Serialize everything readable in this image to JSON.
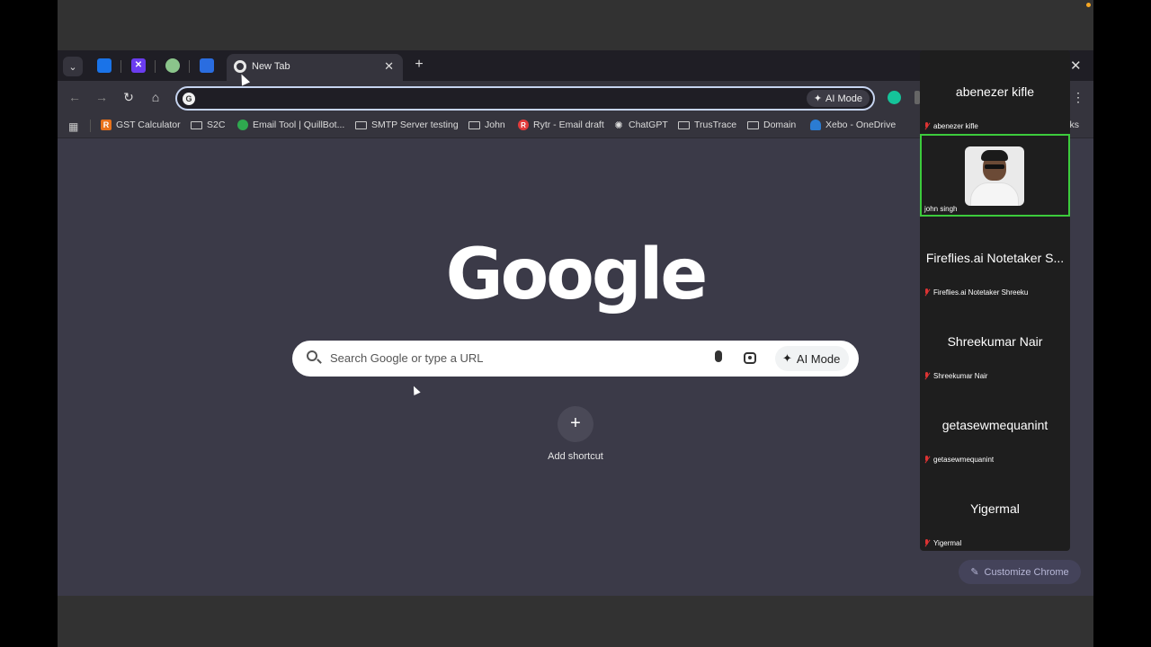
{
  "tabs": {
    "active_title": "New Tab"
  },
  "toolbar": {
    "omnibox_value": "",
    "ai_mode_label": "AI Mode"
  },
  "bookmarks": [
    {
      "label": "GST Calculator",
      "icon": "r-logo-icon"
    },
    {
      "label": "S2C",
      "icon": "folder-icon"
    },
    {
      "label": "Email Tool | QuillBot...",
      "icon": "quillbot-icon"
    },
    {
      "label": "SMTP Server testing",
      "icon": "folder-icon"
    },
    {
      "label": "John",
      "icon": "folder-icon"
    },
    {
      "label": "Rytr - Email draft",
      "icon": "rytr-icon"
    },
    {
      "label": "ChatGPT",
      "icon": "chatgpt-icon"
    },
    {
      "label": "TrusTrace",
      "icon": "folder-icon"
    },
    {
      "label": "Domain",
      "icon": "folder-icon"
    },
    {
      "label": "Xebo - OneDrive",
      "icon": "onedrive-icon"
    }
  ],
  "bookmarks_overflow": "rks",
  "ntp": {
    "logo": "Google",
    "search_placeholder": "Search Google or type a URL",
    "ai_mode_label": "AI Mode",
    "add_shortcut_label": "Add shortcut",
    "customize_label": "Customize Chrome"
  },
  "meeting": {
    "participants": [
      {
        "display": "abenezer kifle",
        "label": "abenezer kifle"
      },
      {
        "display": "",
        "label": "john singh"
      },
      {
        "display": "Fireflies.ai Notetaker S...",
        "label": "Fireflies.ai Notetaker Shreeku"
      },
      {
        "display": "Shreekumar Nair",
        "label": "Shreekumar Nair"
      },
      {
        "display": "getasewmequanint",
        "label": "getasewmequanint"
      },
      {
        "display": "Yigermal",
        "label": "Yigermal"
      }
    ]
  }
}
